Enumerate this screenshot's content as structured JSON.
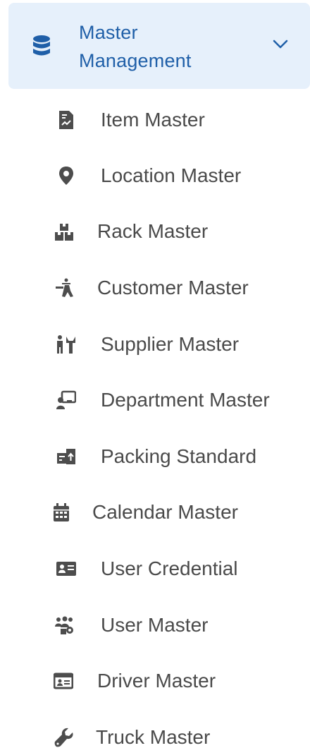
{
  "group": {
    "icon": "database-icon",
    "title_line1": "Master",
    "title_line2": "Management",
    "toggle_icon": "chevron-down-icon"
  },
  "items": [
    {
      "label": "Item Master",
      "icon": "file-chart-icon"
    },
    {
      "label": "Location Master",
      "icon": "map-pin-icon"
    },
    {
      "label": "Rack Master",
      "icon": "boxes-stacked-icon"
    },
    {
      "label": "Customer Master",
      "icon": "person-carry-icon"
    },
    {
      "label": "Supplier Master",
      "icon": "people-carry-icon"
    },
    {
      "label": "Department Master",
      "icon": "chalkboard-user-icon"
    },
    {
      "label": "Packing Standard",
      "icon": "truck-loading-icon"
    },
    {
      "label": "Calendar Master",
      "icon": "calendar-icon"
    },
    {
      "label": "User Credential",
      "icon": "id-card-icon"
    },
    {
      "label": "User Master",
      "icon": "users-gear-icon"
    },
    {
      "label": "Driver Master",
      "icon": "driver-license-icon"
    },
    {
      "label": "Truck Master",
      "icon": "wrench-icon"
    }
  ],
  "colors": {
    "header_bg": "#e6f0fb",
    "header_text": "#1f5fa8",
    "item_text": "#4a4a4a",
    "item_icon": "#4d4d4d"
  }
}
